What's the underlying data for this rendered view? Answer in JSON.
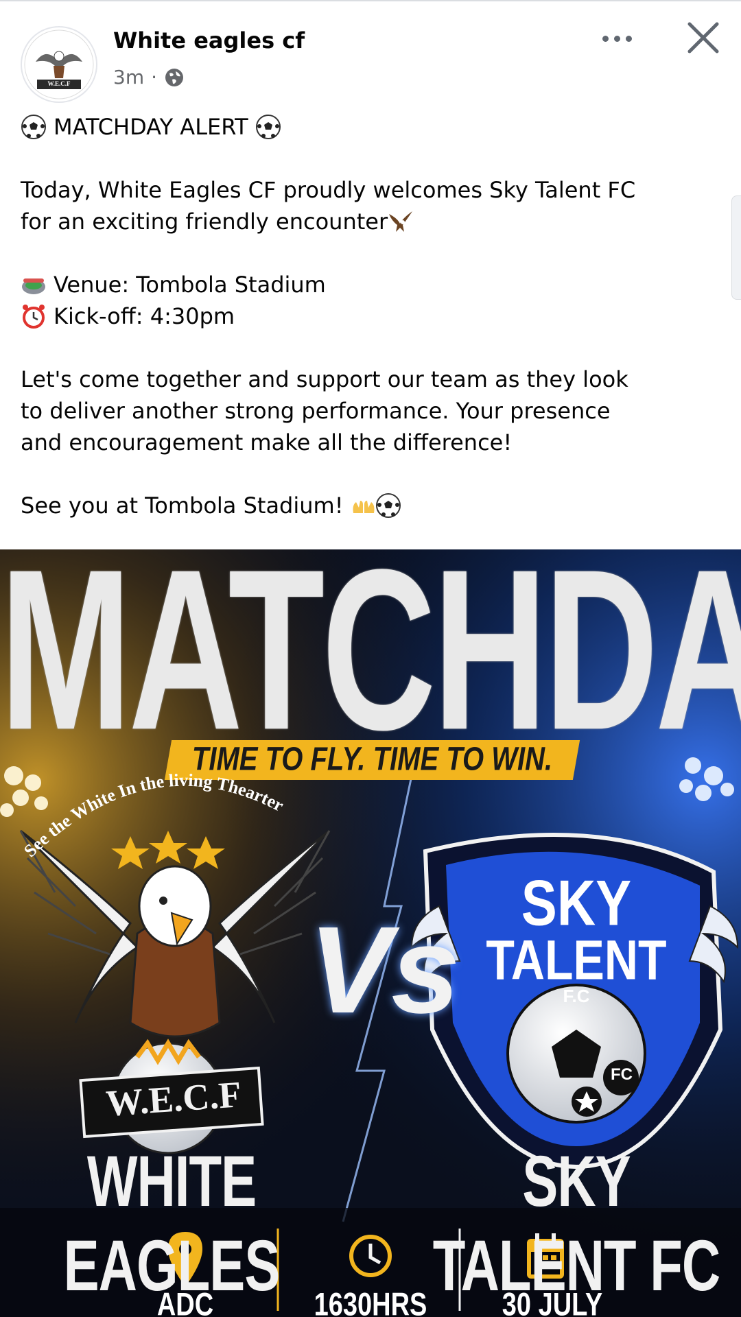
{
  "post": {
    "page_name": "White eagles cf",
    "time_ago": "3m",
    "separator": "·",
    "avatar_text": "W.E.C.F"
  },
  "caption": {
    "alert": "MATCHDAY ALERT",
    "intro_line1": "Today, White Eagles CF proudly welcomes Sky Talent FC",
    "intro_line2": "for an exciting friendly encounter",
    "venue": "Venue: Tombola Stadium",
    "kickoff": "Kick-off: 4:30pm",
    "support_line1": "Let's come together and support our team as they look",
    "support_line2": "to deliver another strong performance. Your presence",
    "support_line3": "and encouragement make all the difference!",
    "closing": "See you at Tombola Stadium!"
  },
  "poster": {
    "headline": "MATCHDAY",
    "tagline": "TIME TO FLY. TIME TO WIN.",
    "arc_text": "See the White In the living Thearter",
    "home_badge_text": "W.E.C.F",
    "versus": "Vs",
    "away_badge_sky": "SKY",
    "away_badge_talent": "TALENT",
    "away_badge_fc": "F.C",
    "away_ball_fc": "FC",
    "home_team": "WHITE EAGLES",
    "away_team": "SKY TALENT FC",
    "venue": "ADC STADIUM",
    "time": "1630HRS",
    "date": "30 JULY"
  },
  "icons": {
    "more": "more-options-icon",
    "close": "close-icon",
    "privacy": "globe-icon",
    "football": "soccer-ball-icon",
    "stadium": "stadium-icon",
    "clock": "alarm-clock-icon",
    "eagle": "eagle-icon",
    "clap": "raising-hands-icon",
    "pin": "location-pin-icon",
    "time": "clock-icon",
    "calendar": "calendar-icon"
  },
  "colors": {
    "accent_gold": "#f2b51e",
    "badge_blue": "#1f4fd6",
    "poster_bg": "#0a0f1d"
  }
}
